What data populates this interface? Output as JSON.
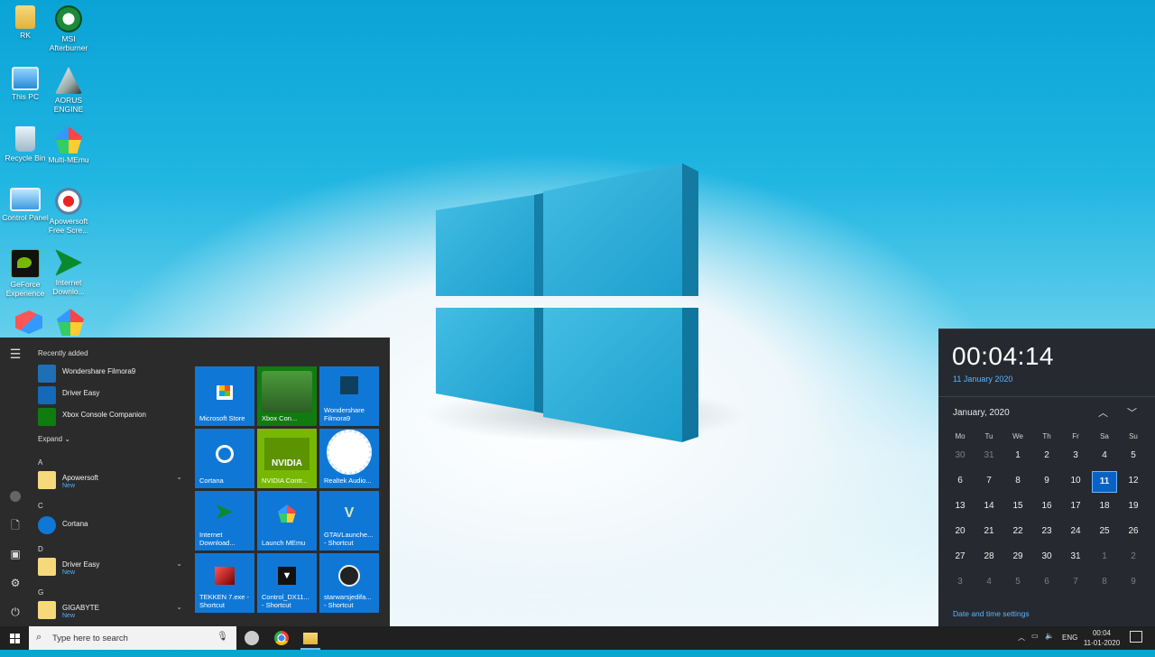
{
  "desktop": {
    "icons": [
      {
        "label": "RK"
      },
      {
        "label": "MSI Afterburner"
      },
      {
        "label": "This PC"
      },
      {
        "label": "AORUS ENGINE"
      },
      {
        "label": "Recycle Bin"
      },
      {
        "label": "Multi-MEmu"
      },
      {
        "label": "Control Panel"
      },
      {
        "label": "Apowersoft Free Scre..."
      },
      {
        "label": "GeForce Experience"
      },
      {
        "label": "Internet Downlo..."
      }
    ]
  },
  "start_menu": {
    "recently_added_label": "Recently added",
    "recent": [
      {
        "name": "Wondershare Filmora9"
      },
      {
        "name": "Driver Easy"
      },
      {
        "name": "Xbox Console Companion"
      }
    ],
    "expand_label": "Expand",
    "groups": [
      {
        "letter": "A",
        "name": "Apowersoft",
        "sub": "New"
      },
      {
        "letter": "C",
        "name": "Cortana",
        "sub": ""
      },
      {
        "letter": "D",
        "name": "Driver Easy",
        "sub": "New"
      },
      {
        "letter": "G",
        "name": "GIGABYTE",
        "sub": "New"
      }
    ],
    "tiles": [
      {
        "label": "Microsoft Store",
        "color": "#0f78d7"
      },
      {
        "label": "Xbox Con...",
        "color": "#107c10"
      },
      {
        "label": "Wondershare Filmora9",
        "color": "#0f78d7"
      },
      {
        "label": "Cortana",
        "color": "#0f78d7"
      },
      {
        "label": "NVIDIA Contr...",
        "color": "#76b900"
      },
      {
        "label": "Realtek Audio...",
        "color": "#0f78d7"
      },
      {
        "label": "Internet Download...",
        "color": "#0f78d7"
      },
      {
        "label": "Launch MEmu",
        "color": "#0f78d7"
      },
      {
        "label": "GTAVLaunche... - Shortcut",
        "color": "#0f78d7"
      },
      {
        "label": "TEKKEN 7.exe - Shortcut",
        "color": "#0f78d7"
      },
      {
        "label": "Control_DX11... - Shortcut",
        "color": "#0f78d7"
      },
      {
        "label": "starwarsjedifa... - Shortcut",
        "color": "#0f78d7"
      }
    ]
  },
  "calendar": {
    "time": "00:04:14",
    "date": "11 January 2020",
    "month": "January, 2020",
    "weekdays": [
      "Mo",
      "Tu",
      "We",
      "Th",
      "Fr",
      "Sa",
      "Su"
    ],
    "weeks": [
      [
        "30",
        "31",
        "1",
        "2",
        "3",
        "4",
        "5"
      ],
      [
        "6",
        "7",
        "8",
        "9",
        "10",
        "11",
        "12"
      ],
      [
        "13",
        "14",
        "15",
        "16",
        "17",
        "18",
        "19"
      ],
      [
        "20",
        "21",
        "22",
        "23",
        "24",
        "25",
        "26"
      ],
      [
        "27",
        "28",
        "29",
        "30",
        "31",
        "1",
        "2"
      ],
      [
        "3",
        "4",
        "5",
        "6",
        "7",
        "8",
        "9"
      ]
    ],
    "today": "11",
    "settings_link": "Date and time settings"
  },
  "taskbar": {
    "search_placeholder": "Type here to search",
    "language": "ENG",
    "clock_time": "00:04",
    "clock_date": "11-01-2020"
  }
}
